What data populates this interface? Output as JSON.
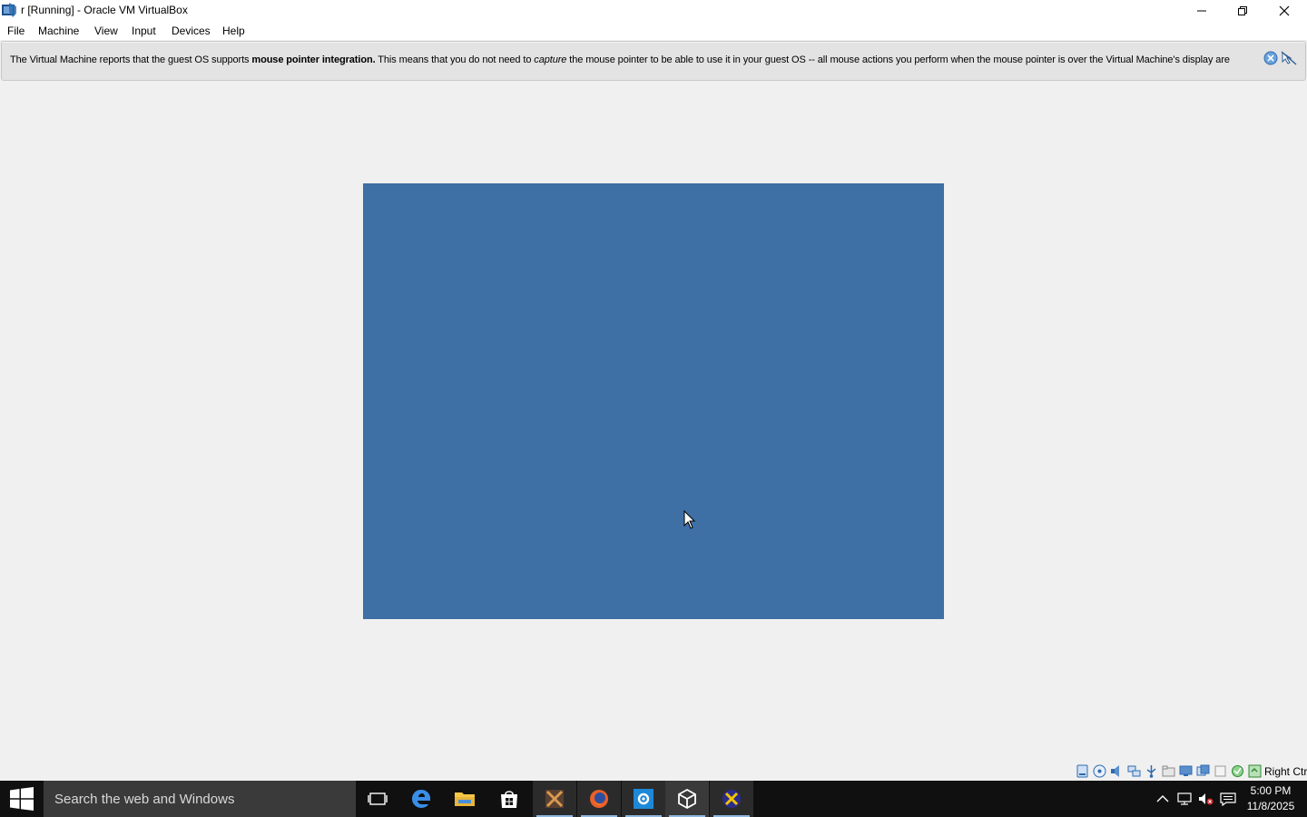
{
  "window": {
    "title": "r [Running] - Oracle VM VirtualBox",
    "icon": "virtualbox-app-icon",
    "controls": [
      "minimize-icon",
      "restore-icon",
      "close-icon"
    ]
  },
  "menu": {
    "items": [
      "File",
      "Machine",
      "View",
      "Input",
      "Devices",
      "Help"
    ]
  },
  "notification": {
    "text_1": "The Virtual Machine reports that the guest OS supports ",
    "bold": "mouse pointer integration.",
    "text_2": " This means that you do not need to ",
    "italic": "capture",
    "text_3": " the mouse pointer to be able to use it in your guest OS -- all mouse actions you perform when the mouse pointer is over the Virtual Machine's display are",
    "buttons": [
      "close-notification-icon",
      "do-not-show-again-icon"
    ]
  },
  "vm_display": {
    "background_color": "#3e6fa5"
  },
  "statusbar": {
    "icons": [
      "hard-disk-icon",
      "optical-drive-icon",
      "audio-icon",
      "network-icon",
      "usb-icon",
      "shared-folders-icon",
      "display-icon",
      "video-capture-icon",
      "virtualization-icon",
      "mouse-integration-icon",
      "keyboard-icon"
    ],
    "host_key": "Right Ctrl"
  },
  "taskbar": {
    "search_placeholder": "Search the web and Windows",
    "apps": [
      "task-view-icon",
      "edge-icon",
      "file-explorer-icon",
      "store-icon",
      "app-icon",
      "firefox-icon",
      "settings-icon",
      "virtualbox-icon",
      "xming-icon"
    ],
    "tray": [
      "show-hidden-icons-chevron",
      "network-icon",
      "volume-muted-icon",
      "action-center-icon"
    ],
    "time": "5:00 PM",
    "date": "11/8/2025"
  },
  "colors": {
    "accent": "#3e6fa5",
    "taskbar": "#101010"
  }
}
